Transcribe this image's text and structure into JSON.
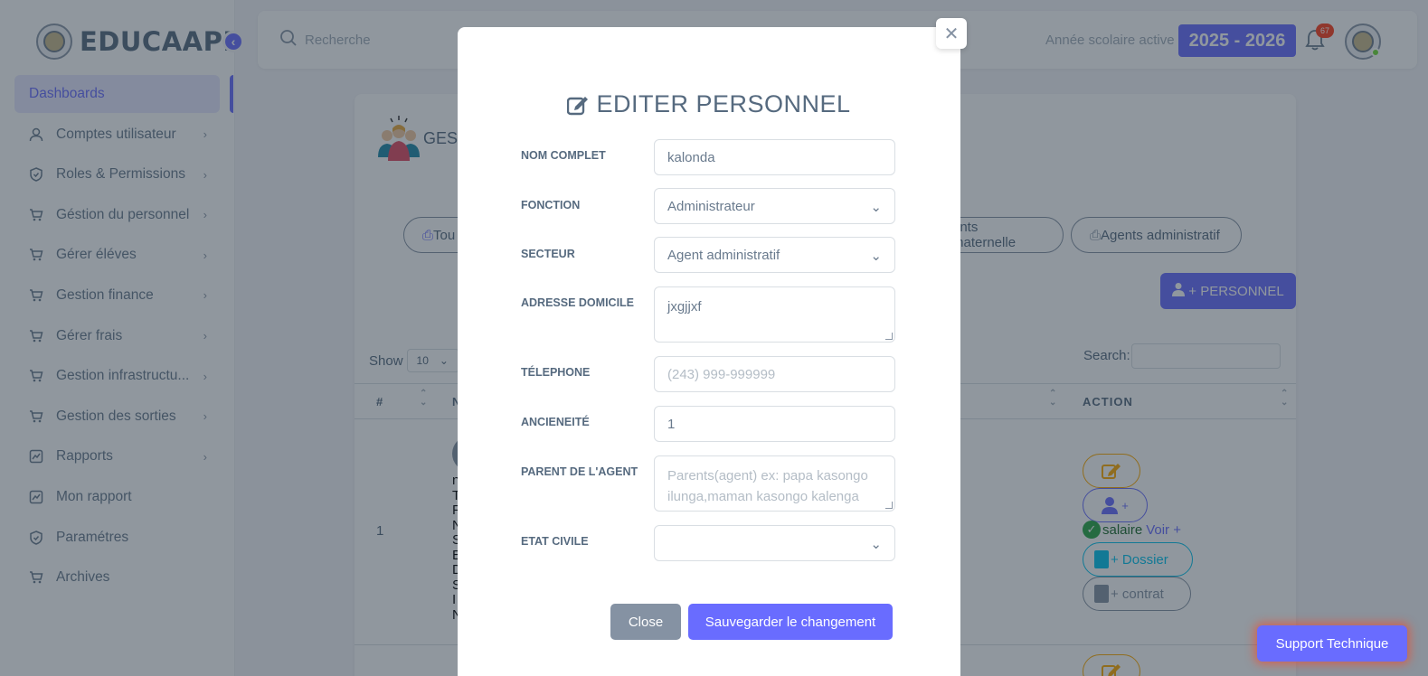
{
  "app": {
    "brand": "EDUCAAPP"
  },
  "sidebar": {
    "items": [
      {
        "label": "Dashboards",
        "icon": "home-icon",
        "active": true
      },
      {
        "label": "Comptes utilisateur",
        "icon": "user-icon"
      },
      {
        "label": "Roles & Permissions",
        "icon": "shield-icon"
      },
      {
        "label": "Géstion du personnel",
        "icon": "cart-icon"
      },
      {
        "label": "Gérer éléves",
        "icon": "cart-icon"
      },
      {
        "label": "Gestion finance",
        "icon": "cart-icon"
      },
      {
        "label": "Gérer frais",
        "icon": "cart-icon"
      },
      {
        "label": "Gestion infrastructu...",
        "icon": "cart-icon"
      },
      {
        "label": "Gestion des sorties",
        "icon": "cart-icon"
      },
      {
        "label": "Rapports",
        "icon": "chart-icon"
      },
      {
        "label": "Mon rapport",
        "icon": "chart-icon"
      },
      {
        "label": "Paramétres",
        "icon": "shield-icon"
      },
      {
        "label": "Archives",
        "icon": "cart-icon"
      }
    ]
  },
  "navbar": {
    "search_placeholder": "Recherche",
    "year_label": "Année scolaire active :",
    "year_value": "2025 - 2026",
    "notification_count": "67"
  },
  "page": {
    "title_fragment": "GEST",
    "filters": [
      "Tou",
      "ants maternelle",
      "Agents administratif"
    ],
    "add_button": "+ PERSONNEL",
    "show_label": "Show",
    "show_value": "10",
    "search_label": "Search:",
    "columns": {
      "num": "#",
      "name_fragment": "N",
      "action": "ACTION"
    },
    "row": {
      "num": "1",
      "letters": "n\nT\nF\nN\nS\nE\nD\nS\nI\nN",
      "salaire": "salaire",
      "voir": "Voir +",
      "dossier": "+ Dossier",
      "contrat": "+ contrat"
    }
  },
  "modal": {
    "title": "EDITER PERSONNEL",
    "fields": {
      "nom_label": "NOM COMPLET",
      "nom_value": "kalonda",
      "fonction_label": "FONCTION",
      "fonction_value": "Administrateur",
      "secteur_label": "SECTEUR",
      "secteur_value": "Agent administratif",
      "adresse_label": "ADRESSE DOMICILE",
      "adresse_value": "jxgjjxf",
      "telephone_label": "TÉLEPHONE",
      "telephone_placeholder": "(243) 999-999999",
      "anciennete_label": "ANCIENEITÉ",
      "anciennete_value": "1",
      "parent_label": "PARENT DE L'AGENT",
      "parent_placeholder": "Parents(agent) ex: papa kasongo ilunga,maman kasongo kalenga",
      "etat_label": "ETAT CIVILE",
      "etat_value": ""
    },
    "close_button": "Close",
    "save_button": "Sauvegarder le changement"
  },
  "support": {
    "label": "Support Technique"
  }
}
